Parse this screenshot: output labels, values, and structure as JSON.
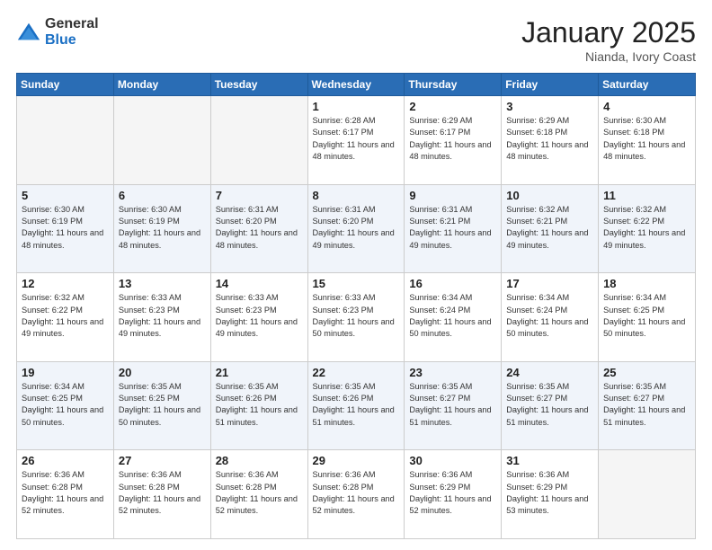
{
  "logo": {
    "general": "General",
    "blue": "Blue"
  },
  "header": {
    "month": "January 2025",
    "location": "Nianda, Ivory Coast"
  },
  "weekdays": [
    "Sunday",
    "Monday",
    "Tuesday",
    "Wednesday",
    "Thursday",
    "Friday",
    "Saturday"
  ],
  "weeks": [
    [
      {
        "day": "",
        "sunrise": "",
        "sunset": "",
        "daylight": ""
      },
      {
        "day": "",
        "sunrise": "",
        "sunset": "",
        "daylight": ""
      },
      {
        "day": "",
        "sunrise": "",
        "sunset": "",
        "daylight": ""
      },
      {
        "day": "1",
        "sunrise": "Sunrise: 6:28 AM",
        "sunset": "Sunset: 6:17 PM",
        "daylight": "Daylight: 11 hours and 48 minutes."
      },
      {
        "day": "2",
        "sunrise": "Sunrise: 6:29 AM",
        "sunset": "Sunset: 6:17 PM",
        "daylight": "Daylight: 11 hours and 48 minutes."
      },
      {
        "day": "3",
        "sunrise": "Sunrise: 6:29 AM",
        "sunset": "Sunset: 6:18 PM",
        "daylight": "Daylight: 11 hours and 48 minutes."
      },
      {
        "day": "4",
        "sunrise": "Sunrise: 6:30 AM",
        "sunset": "Sunset: 6:18 PM",
        "daylight": "Daylight: 11 hours and 48 minutes."
      }
    ],
    [
      {
        "day": "5",
        "sunrise": "Sunrise: 6:30 AM",
        "sunset": "Sunset: 6:19 PM",
        "daylight": "Daylight: 11 hours and 48 minutes."
      },
      {
        "day": "6",
        "sunrise": "Sunrise: 6:30 AM",
        "sunset": "Sunset: 6:19 PM",
        "daylight": "Daylight: 11 hours and 48 minutes."
      },
      {
        "day": "7",
        "sunrise": "Sunrise: 6:31 AM",
        "sunset": "Sunset: 6:20 PM",
        "daylight": "Daylight: 11 hours and 48 minutes."
      },
      {
        "day": "8",
        "sunrise": "Sunrise: 6:31 AM",
        "sunset": "Sunset: 6:20 PM",
        "daylight": "Daylight: 11 hours and 49 minutes."
      },
      {
        "day": "9",
        "sunrise": "Sunrise: 6:31 AM",
        "sunset": "Sunset: 6:21 PM",
        "daylight": "Daylight: 11 hours and 49 minutes."
      },
      {
        "day": "10",
        "sunrise": "Sunrise: 6:32 AM",
        "sunset": "Sunset: 6:21 PM",
        "daylight": "Daylight: 11 hours and 49 minutes."
      },
      {
        "day": "11",
        "sunrise": "Sunrise: 6:32 AM",
        "sunset": "Sunset: 6:22 PM",
        "daylight": "Daylight: 11 hours and 49 minutes."
      }
    ],
    [
      {
        "day": "12",
        "sunrise": "Sunrise: 6:32 AM",
        "sunset": "Sunset: 6:22 PM",
        "daylight": "Daylight: 11 hours and 49 minutes."
      },
      {
        "day": "13",
        "sunrise": "Sunrise: 6:33 AM",
        "sunset": "Sunset: 6:23 PM",
        "daylight": "Daylight: 11 hours and 49 minutes."
      },
      {
        "day": "14",
        "sunrise": "Sunrise: 6:33 AM",
        "sunset": "Sunset: 6:23 PM",
        "daylight": "Daylight: 11 hours and 49 minutes."
      },
      {
        "day": "15",
        "sunrise": "Sunrise: 6:33 AM",
        "sunset": "Sunset: 6:23 PM",
        "daylight": "Daylight: 11 hours and 50 minutes."
      },
      {
        "day": "16",
        "sunrise": "Sunrise: 6:34 AM",
        "sunset": "Sunset: 6:24 PM",
        "daylight": "Daylight: 11 hours and 50 minutes."
      },
      {
        "day": "17",
        "sunrise": "Sunrise: 6:34 AM",
        "sunset": "Sunset: 6:24 PM",
        "daylight": "Daylight: 11 hours and 50 minutes."
      },
      {
        "day": "18",
        "sunrise": "Sunrise: 6:34 AM",
        "sunset": "Sunset: 6:25 PM",
        "daylight": "Daylight: 11 hours and 50 minutes."
      }
    ],
    [
      {
        "day": "19",
        "sunrise": "Sunrise: 6:34 AM",
        "sunset": "Sunset: 6:25 PM",
        "daylight": "Daylight: 11 hours and 50 minutes."
      },
      {
        "day": "20",
        "sunrise": "Sunrise: 6:35 AM",
        "sunset": "Sunset: 6:25 PM",
        "daylight": "Daylight: 11 hours and 50 minutes."
      },
      {
        "day": "21",
        "sunrise": "Sunrise: 6:35 AM",
        "sunset": "Sunset: 6:26 PM",
        "daylight": "Daylight: 11 hours and 51 minutes."
      },
      {
        "day": "22",
        "sunrise": "Sunrise: 6:35 AM",
        "sunset": "Sunset: 6:26 PM",
        "daylight": "Daylight: 11 hours and 51 minutes."
      },
      {
        "day": "23",
        "sunrise": "Sunrise: 6:35 AM",
        "sunset": "Sunset: 6:27 PM",
        "daylight": "Daylight: 11 hours and 51 minutes."
      },
      {
        "day": "24",
        "sunrise": "Sunrise: 6:35 AM",
        "sunset": "Sunset: 6:27 PM",
        "daylight": "Daylight: 11 hours and 51 minutes."
      },
      {
        "day": "25",
        "sunrise": "Sunrise: 6:35 AM",
        "sunset": "Sunset: 6:27 PM",
        "daylight": "Daylight: 11 hours and 51 minutes."
      }
    ],
    [
      {
        "day": "26",
        "sunrise": "Sunrise: 6:36 AM",
        "sunset": "Sunset: 6:28 PM",
        "daylight": "Daylight: 11 hours and 52 minutes."
      },
      {
        "day": "27",
        "sunrise": "Sunrise: 6:36 AM",
        "sunset": "Sunset: 6:28 PM",
        "daylight": "Daylight: 11 hours and 52 minutes."
      },
      {
        "day": "28",
        "sunrise": "Sunrise: 6:36 AM",
        "sunset": "Sunset: 6:28 PM",
        "daylight": "Daylight: 11 hours and 52 minutes."
      },
      {
        "day": "29",
        "sunrise": "Sunrise: 6:36 AM",
        "sunset": "Sunset: 6:28 PM",
        "daylight": "Daylight: 11 hours and 52 minutes."
      },
      {
        "day": "30",
        "sunrise": "Sunrise: 6:36 AM",
        "sunset": "Sunset: 6:29 PM",
        "daylight": "Daylight: 11 hours and 52 minutes."
      },
      {
        "day": "31",
        "sunrise": "Sunrise: 6:36 AM",
        "sunset": "Sunset: 6:29 PM",
        "daylight": "Daylight: 11 hours and 53 minutes."
      },
      {
        "day": "",
        "sunrise": "",
        "sunset": "",
        "daylight": ""
      }
    ]
  ]
}
